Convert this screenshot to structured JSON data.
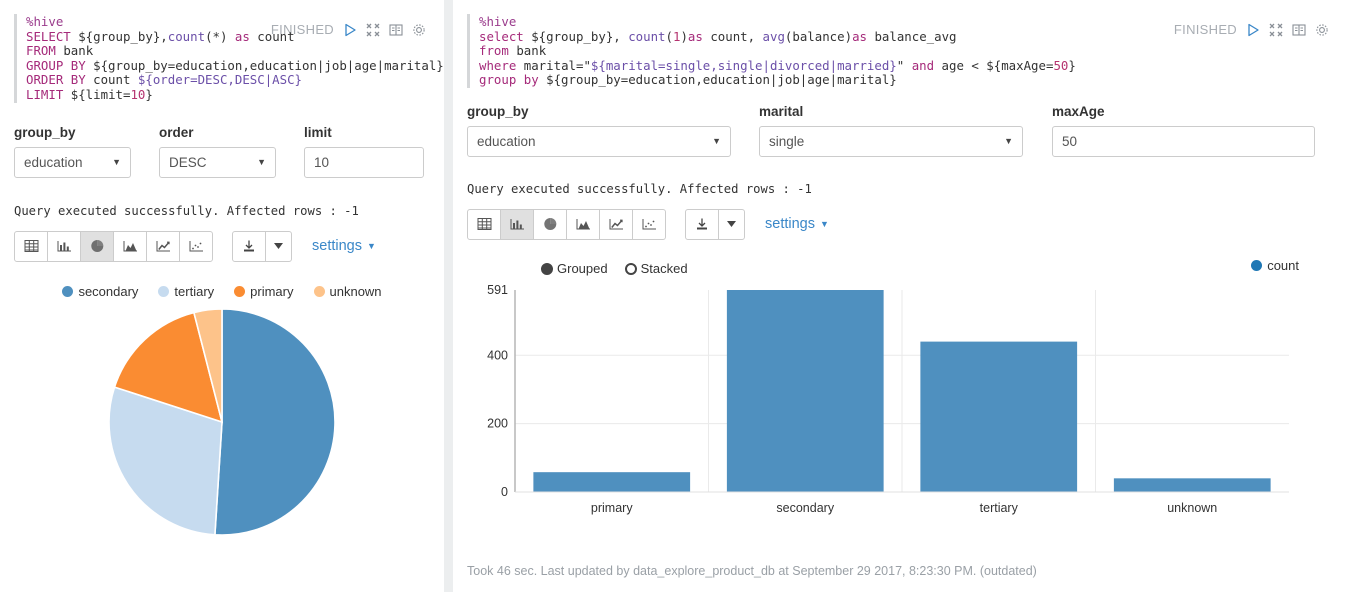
{
  "left_paragraph": {
    "status": "FINISHED",
    "icons": [
      "play-icon",
      "collapse-icon",
      "book-icon",
      "gear-icon"
    ],
    "code_lines": [
      [
        {
          "t": "%hive",
          "c": "magic"
        }
      ],
      [
        {
          "t": "SELECT ",
          "c": "kw"
        },
        {
          "t": "${group_by},",
          "c": "plain"
        },
        {
          "t": "count",
          "c": "fn"
        },
        {
          "t": "(*) ",
          "c": "plain"
        },
        {
          "t": "as ",
          "c": "kw"
        },
        {
          "t": "count",
          "c": "plain"
        }
      ],
      [
        {
          "t": "FROM ",
          "c": "kw"
        },
        {
          "t": "bank",
          "c": "plain"
        }
      ],
      [
        {
          "t": "GROUP BY ",
          "c": "kw"
        },
        {
          "t": "${group_by=education,education|job|age|marital}",
          "c": "plain"
        }
      ],
      [
        {
          "t": "ORDER BY ",
          "c": "kw"
        },
        {
          "t": "count ",
          "c": "plain"
        },
        {
          "t": "${order=DESC,DESC|ASC}",
          "c": "fn"
        }
      ],
      [
        {
          "t": "LIMIT ",
          "c": "kw"
        },
        {
          "t": "${limit=",
          "c": "plain"
        },
        {
          "t": "10",
          "c": "num"
        },
        {
          "t": "}",
          "c": "plain"
        }
      ]
    ],
    "fields": [
      {
        "label": "group_by",
        "type": "select",
        "value": "education"
      },
      {
        "label": "order",
        "type": "select",
        "value": "DESC"
      },
      {
        "label": "limit",
        "type": "text",
        "value": "10"
      }
    ],
    "result_message": "Query executed successfully. Affected rows : -1",
    "viz_buttons": [
      "table-icon",
      "bar-chart-icon",
      "pie-chart-icon",
      "area-chart-icon",
      "line-chart-icon",
      "scatter-chart-icon"
    ],
    "viz_active_index": 2,
    "download_label": "download-icon",
    "settings_label": "settings"
  },
  "right_paragraph": {
    "status": "FINISHED",
    "icons": [
      "play-icon",
      "collapse-icon",
      "book-icon",
      "gear-icon"
    ],
    "code_lines": [
      [
        {
          "t": "%hive",
          "c": "magic"
        }
      ],
      [
        {
          "t": "select ",
          "c": "kw"
        },
        {
          "t": "${group_by}, ",
          "c": "plain"
        },
        {
          "t": "count",
          "c": "fn"
        },
        {
          "t": "(",
          "c": "plain"
        },
        {
          "t": "1",
          "c": "num"
        },
        {
          "t": ")",
          "c": "plain"
        },
        {
          "t": "as ",
          "c": "kw"
        },
        {
          "t": "count, ",
          "c": "plain"
        },
        {
          "t": "avg",
          "c": "fn"
        },
        {
          "t": "(balance)",
          "c": "plain"
        },
        {
          "t": "as ",
          "c": "kw"
        },
        {
          "t": "balance_avg",
          "c": "plain"
        }
      ],
      [
        {
          "t": "from ",
          "c": "kw"
        },
        {
          "t": "bank",
          "c": "plain"
        }
      ],
      [
        {
          "t": "where ",
          "c": "kw"
        },
        {
          "t": "marital=\"",
          "c": "plain"
        },
        {
          "t": "${marital=single,single|divorced|married}",
          "c": "fn"
        },
        {
          "t": "\" ",
          "c": "plain"
        },
        {
          "t": "and ",
          "c": "kw"
        },
        {
          "t": "age < ${maxAge=",
          "c": "plain"
        },
        {
          "t": "50",
          "c": "num"
        },
        {
          "t": "}",
          "c": "plain"
        }
      ],
      [
        {
          "t": "group by ",
          "c": "kw"
        },
        {
          "t": "${group_by=education,education|job|age|marital}",
          "c": "plain"
        }
      ]
    ],
    "fields": [
      {
        "label": "group_by",
        "type": "select",
        "value": "education"
      },
      {
        "label": "marital",
        "type": "select",
        "value": "single"
      },
      {
        "label": "maxAge",
        "type": "text",
        "value": "50"
      }
    ],
    "result_message": "Query executed successfully. Affected rows : -1",
    "viz_buttons": [
      "table-icon",
      "bar-chart-icon",
      "pie-chart-icon",
      "area-chart-icon",
      "line-chart-icon",
      "scatter-chart-icon"
    ],
    "viz_active_index": 1,
    "download_label": "download-icon",
    "settings_label": "settings",
    "bar_mode_options": [
      {
        "label": "Grouped",
        "selected": true
      },
      {
        "label": "Stacked",
        "selected": false
      }
    ],
    "footer": "Took 46 sec. Last updated by data_explore_product_db at September 29 2017, 8:23:30 PM. (outdated)"
  },
  "chart_data": [
    {
      "type": "pie",
      "title": "",
      "legend_position": "top",
      "labels": [
        "secondary",
        "tertiary",
        "primary",
        "unknown"
      ],
      "values": [
        51,
        29,
        16,
        4
      ],
      "colors": [
        "#4f90bf",
        "#c6dbef",
        "#fa8c32",
        "#fdc38a"
      ]
    },
    {
      "type": "bar",
      "title": "",
      "xlabel": "",
      "ylabel": "",
      "categories": [
        "primary",
        "secondary",
        "tertiary",
        "unknown"
      ],
      "series": [
        {
          "name": "count",
          "values": [
            58,
            591,
            440,
            40
          ],
          "color": "#4f90bf"
        }
      ],
      "ylim": [
        0,
        591
      ],
      "yticks": [
        "0",
        "200",
        "400",
        "591"
      ],
      "grid": true,
      "legend_position": "top-right"
    }
  ]
}
